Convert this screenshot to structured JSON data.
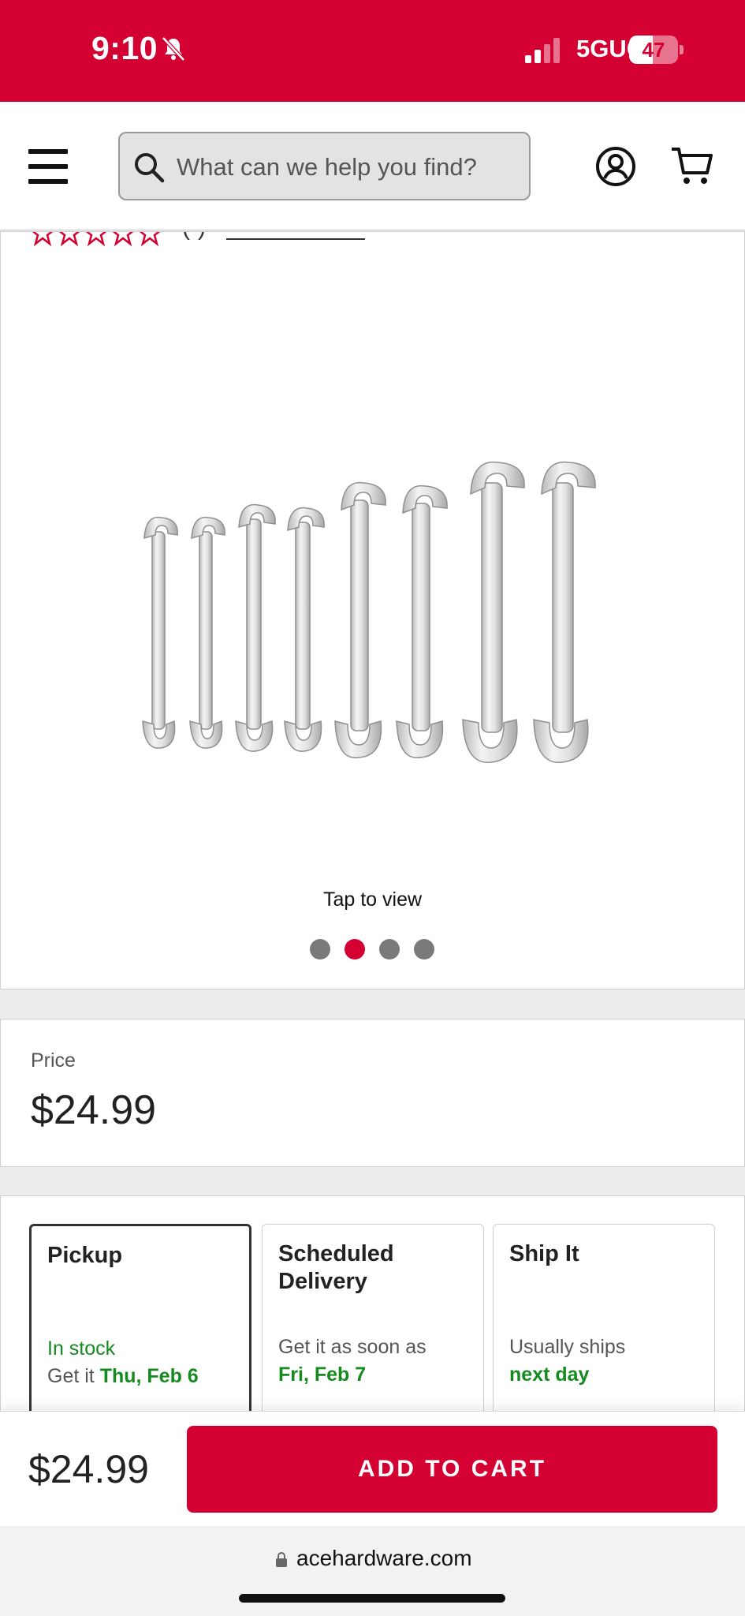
{
  "status_bar": {
    "time": "9:10",
    "network": "5GUC",
    "battery": "47",
    "colors": {
      "background": "#d50032"
    }
  },
  "header": {
    "search": {
      "placeholder": "What can we help you find?"
    },
    "icons": {
      "menu": "menu-icon",
      "search": "search-icon",
      "account": "account-icon",
      "cart": "cart-icon"
    }
  },
  "gallery": {
    "rating_count": "(-)",
    "tap_to_view": "Tap to view",
    "image_subject": "angled open-end wrench set, 8 wrenches",
    "dots_total": 4,
    "active_dot": 2
  },
  "price": {
    "label": "Price",
    "value": "$24.99"
  },
  "fulfillment": {
    "options": [
      {
        "title": "Pickup",
        "line1": "In stock",
        "line2_prefix": "Get it ",
        "line2_emph": "Thu, Feb 6",
        "selected": true
      },
      {
        "title": "Scheduled Delivery",
        "line1": "Get it as soon as",
        "line2_prefix": "",
        "line2_emph": "Fri, Feb 7",
        "selected": false
      },
      {
        "title": "Ship It",
        "line1": "Usually ships",
        "line2_prefix": "",
        "line2_emph": "next day",
        "selected": false
      }
    ]
  },
  "bottom_bar": {
    "price": "$24.99",
    "add_to_cart": "ADD TO CART"
  },
  "browser": {
    "url": "acehardware.com"
  },
  "colors": {
    "brand_red": "#d50032",
    "in_stock_green": "#158a1e"
  }
}
